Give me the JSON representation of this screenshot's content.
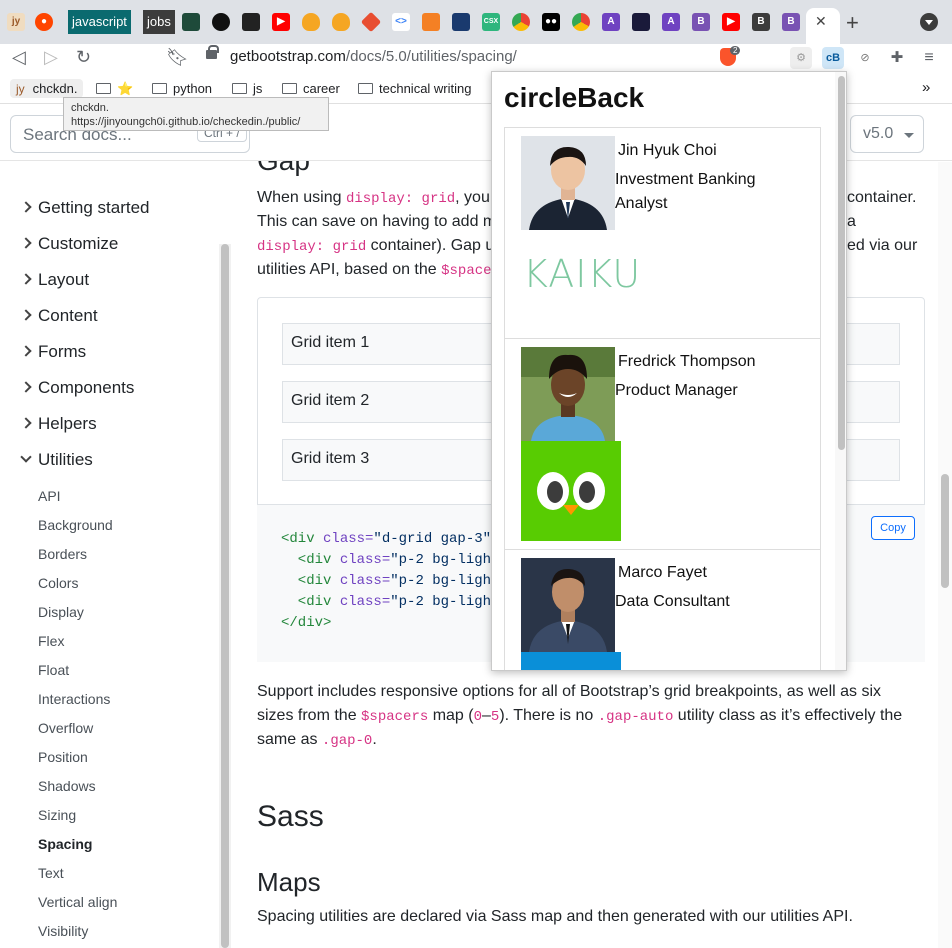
{
  "browser": {
    "tabs": [
      {
        "label": "jy",
        "color": "#f5e6d3"
      },
      {
        "label": "reddit",
        "color": "#ff4500"
      },
      {
        "label": "javascript",
        "color": "#0a6a6f"
      },
      {
        "label": "jobs",
        "color": "#3c3c3c"
      }
    ],
    "url_host": "getbootstrap.com",
    "url_path": "/docs/5.0/utilities/spacing/",
    "brave_badge": "2",
    "ext_active_label": "cB",
    "bookmarks": [
      {
        "label": "chckdn."
      },
      {
        "label": "⭐"
      },
      {
        "label": "python"
      },
      {
        "label": "js"
      },
      {
        "label": "career"
      },
      {
        "label": "technical writing"
      }
    ],
    "bookmark_overflow": "»",
    "tooltip": {
      "title": "chckdn.",
      "url": "https://jinyoungch0i.github.io/checkedin./public/"
    }
  },
  "docs": {
    "search_placeholder": "Search docs...",
    "search_shortcut": "Ctrl + /",
    "version": "v5.0",
    "sidebar": {
      "sections": [
        "Getting started",
        "Customize",
        "Layout",
        "Content",
        "Forms",
        "Components",
        "Helpers",
        "Utilities"
      ],
      "utilities": [
        "API",
        "Background",
        "Borders",
        "Colors",
        "Display",
        "Flex",
        "Float",
        "Interactions",
        "Overflow",
        "Position",
        "Shadows",
        "Sizing",
        "Spacing",
        "Text",
        "Vertical align",
        "Visibility"
      ]
    },
    "gap_title": "Gap",
    "gap_p1_a": "When using ",
    "gap_p1_code": "display: grid",
    "gap_p1_b": ", you",
    "gap_p1_right": "container.",
    "gap_p2_a": "This can save on having to add m",
    "gap_p2_right": "a",
    "gap_p3_code": "display: grid",
    "gap_p3_a": " container). Gap u",
    "gap_p3_right": "ed via our",
    "gap_p4_a": "utilities API, based on the ",
    "gap_p4_code": "$space",
    "grid_items": [
      "Grid item 1",
      "Grid item 2",
      "Grid item 3"
    ],
    "copy_label": "Copy",
    "code_lines": [
      {
        "tag_open": "<div",
        "attr": " class=",
        "str": "\"d-grid gap-3\""
      },
      {
        "tag_open": "  <div",
        "attr": " class=",
        "str": "\"p-2 bg-ligh"
      },
      {
        "tag_open": "  <div",
        "attr": " class=",
        "str": "\"p-2 bg-ligh"
      },
      {
        "tag_open": "  <div",
        "attr": " class=",
        "str": "\"p-2 bg-ligh"
      }
    ],
    "code_close": "</div>",
    "support_1a": "Support includes responsive options for all of Bootstrap’s grid breakpoints, as well as six",
    "support_2a": "sizes from the ",
    "support_2code": "$spacers",
    "support_2b": " map (",
    "support_2code2": "0",
    "support_2dash": "–",
    "support_2code3": "5",
    "support_2c": "). There is no ",
    "support_2code4": ".gap-auto",
    "support_2d": " utility class as it’s effectively the",
    "support_3a": "same as ",
    "support_3code": ".gap-0",
    "support_3b": ".",
    "sass_title": "Sass",
    "maps_title": "Maps",
    "maps_text": "Spacing utilities are declared via Sass map and then generated with our utilities API."
  },
  "popup": {
    "title": "circleBack",
    "people": [
      {
        "name": "Jin Hyuk Choi",
        "role": "Investment Banking Analyst",
        "company_logo": "KAIKU",
        "logo_color": "#7ec8a0"
      },
      {
        "name": "Fredrick Thompson",
        "role": "Product Manager",
        "company_logo": "duolingo-owl",
        "logo_color": "#58cc02"
      },
      {
        "name": "Marco Fayet",
        "role": "Data Consultant",
        "company_logo": "blue-logo",
        "logo_color": "#0a8fd8"
      }
    ]
  }
}
